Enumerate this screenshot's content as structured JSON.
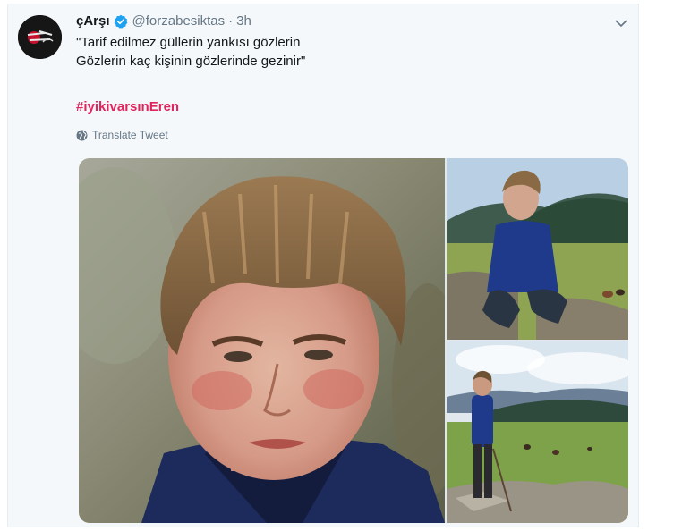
{
  "tweet": {
    "display_name": "çArşı",
    "handle": "@forzabesiktas",
    "separator": "·",
    "time": "3h",
    "text_lines": [
      "\"Tarif edilmez güllerin yankısı gözlerin",
      "Gözlerin kaç kişinin gözlerinde gezinir\""
    ],
    "hashtag": "#iyikivarsınEren",
    "translate_label": "Translate Tweet"
  },
  "icons": {
    "verified": "verified-badge-icon",
    "menu": "chevron-down-icon",
    "translate": "globe-icon"
  },
  "colors": {
    "hashtag": "#e0245e",
    "verified": "#1da1f2",
    "muted": "#657786",
    "card_bg": "#f5f8fa"
  },
  "media": {
    "count": 3
  }
}
